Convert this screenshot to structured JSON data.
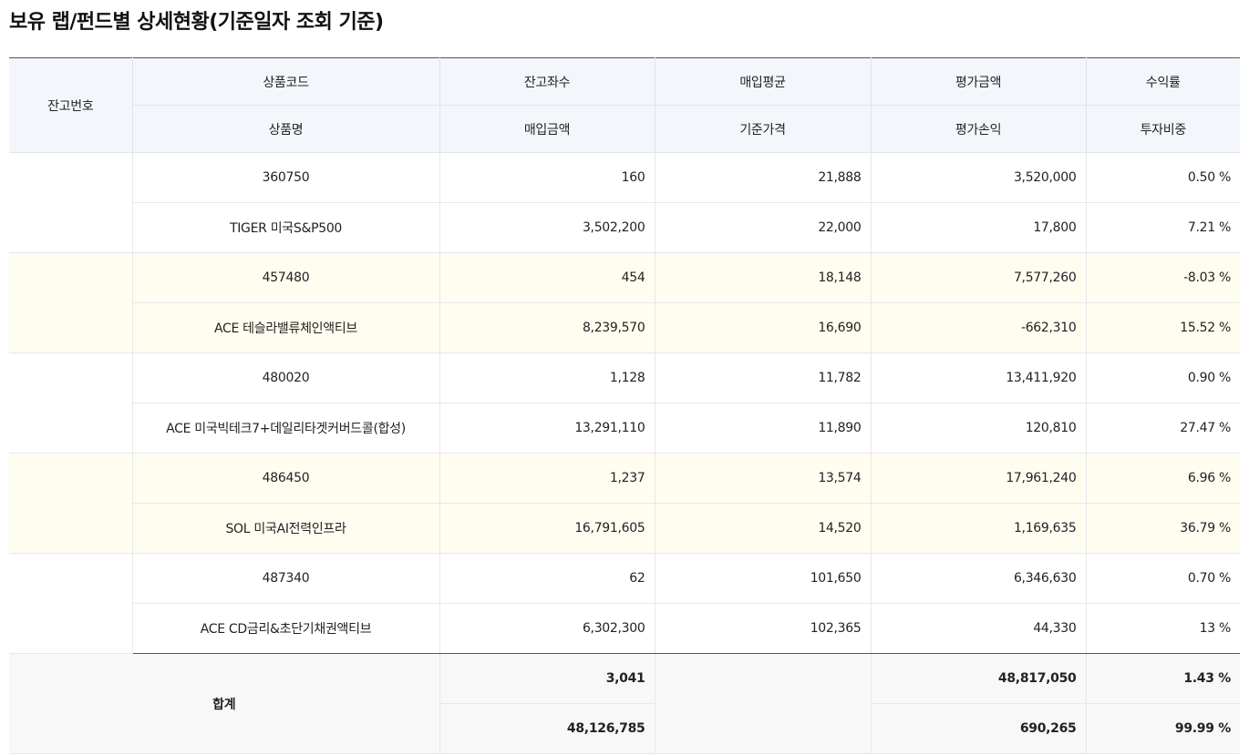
{
  "page_title": "보유 랩/펀드별 상세현황(기준일자 조회 기준)",
  "headers": {
    "account_no": "잔고번호",
    "row1": [
      "상품코드",
      "잔고좌수",
      "매입평균",
      "평가금액",
      "수익률"
    ],
    "row2": [
      "상품명",
      "매입금액",
      "기준가격",
      "평가손익",
      "투자비중"
    ]
  },
  "holdings": [
    {
      "code": "360750",
      "name": "TIGER 미국S&P500",
      "units": "160",
      "purchase_amount": "3,502,200",
      "avg_price": "21,888",
      "base_price": "22,000",
      "eval_amount": "3,520,000",
      "eval_pnl": "17,800",
      "return_rate": "0.50 %",
      "weight": "7.21 %"
    },
    {
      "code": "457480",
      "name": "ACE 테슬라밸류체인액티브",
      "units": "454",
      "purchase_amount": "8,239,570",
      "avg_price": "18,148",
      "base_price": "16,690",
      "eval_amount": "7,577,260",
      "eval_pnl": "-662,310",
      "return_rate": "-8.03 %",
      "weight": "15.52 %"
    },
    {
      "code": "480020",
      "name": "ACE 미국빅테크7+데일리타겟커버드콜(합성)",
      "units": "1,128",
      "purchase_amount": "13,291,110",
      "avg_price": "11,782",
      "base_price": "11,890",
      "eval_amount": "13,411,920",
      "eval_pnl": "120,810",
      "return_rate": "0.90 %",
      "weight": "27.47 %"
    },
    {
      "code": "486450",
      "name": "SOL 미국AI전력인프라",
      "units": "1,237",
      "purchase_amount": "16,791,605",
      "avg_price": "13,574",
      "base_price": "14,520",
      "eval_amount": "17,961,240",
      "eval_pnl": "1,169,635",
      "return_rate": "6.96 %",
      "weight": "36.79 %"
    },
    {
      "code": "487340",
      "name": "ACE CD금리&초단기채권액티브",
      "units": "62",
      "purchase_amount": "6,302,300",
      "avg_price": "101,650",
      "base_price": "102,365",
      "eval_amount": "6,346,630",
      "eval_pnl": "44,330",
      "return_rate": "0.70 %",
      "weight": "13 %"
    }
  ],
  "total": {
    "label": "합계",
    "units": "3,041",
    "purchase_amount": "48,126,785",
    "eval_amount": "48,817,050",
    "eval_pnl": "690,265",
    "return_rate": "1.43 %",
    "weight": "99.99 %"
  }
}
